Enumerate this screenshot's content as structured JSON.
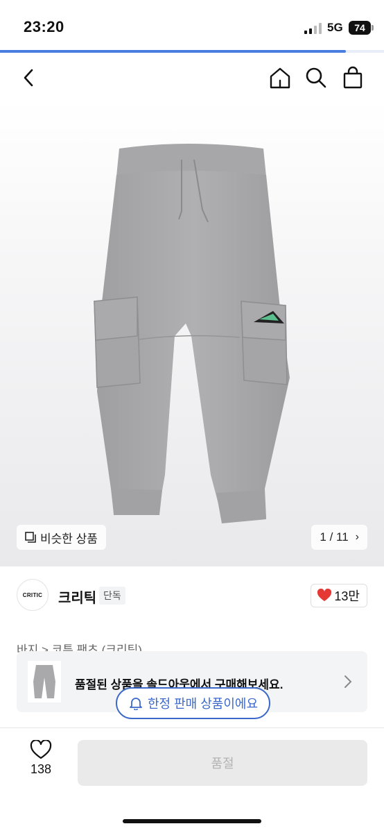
{
  "status_bar": {
    "time": "23:20",
    "network": "5G",
    "battery": "74"
  },
  "progress": {
    "fraction": 0.9
  },
  "nav": {
    "back_icon": "chevron-left-icon",
    "home_icon": "home-icon",
    "search_icon": "search-icon",
    "bag_icon": "shopping-bag-icon"
  },
  "gallery": {
    "similar_label": "비슷한 상품",
    "page_indicator": "1 / 11",
    "current_page": 1,
    "total_pages": 11
  },
  "brand": {
    "logo_text": "CRITIC",
    "name": "크리틱",
    "badge": "단독",
    "likes": "13만",
    "like_color": "#e53935"
  },
  "breadcrumb": "바지 > 코튼 팬츠 (크리틱)",
  "soldout_banner": {
    "message": "품절된 상품을 솔드아웃에서 구매해보세요."
  },
  "limited_pill": {
    "label": "한정 판매 상품이에요",
    "color": "#3b68c9"
  },
  "bottom_bar": {
    "wish_count": "138",
    "buy_label": "품절"
  }
}
